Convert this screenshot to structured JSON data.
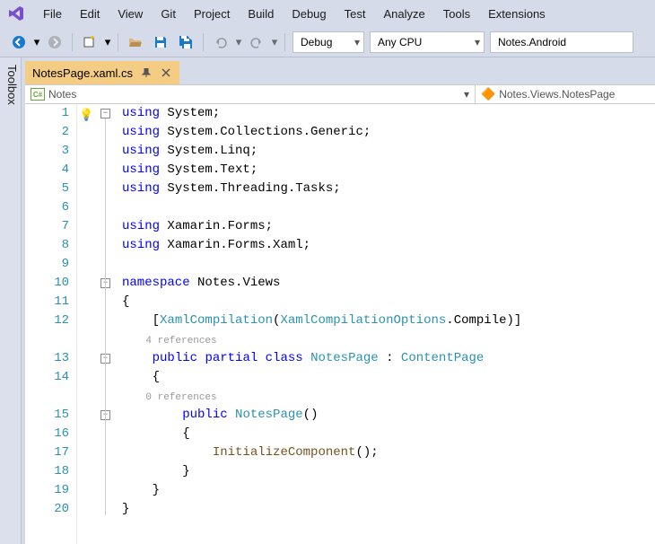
{
  "menu": {
    "items": [
      "File",
      "Edit",
      "View",
      "Git",
      "Project",
      "Build",
      "Debug",
      "Test",
      "Analyze",
      "Tools",
      "Extensions"
    ]
  },
  "toolbar": {
    "debug": "Debug",
    "platform": "Any CPU",
    "startup": "Notes.Android"
  },
  "toolbox_label": "Toolbox",
  "file_tab": {
    "name": "NotesPage.xaml.cs"
  },
  "navbar": {
    "scope": "Notes",
    "member": "Notes.Views.NotesPage"
  },
  "code": {
    "lines": [
      {
        "n": 1,
        "tokens": [
          {
            "t": "kw",
            "v": "using"
          },
          {
            "t": "sp",
            "v": " "
          },
          {
            "t": "na",
            "v": "System"
          },
          {
            "t": "pn",
            "v": ";"
          }
        ]
      },
      {
        "n": 2,
        "tokens": [
          {
            "t": "kw",
            "v": "using"
          },
          {
            "t": "sp",
            "v": " "
          },
          {
            "t": "na",
            "v": "System.Collections.Generic"
          },
          {
            "t": "pn",
            "v": ";"
          }
        ]
      },
      {
        "n": 3,
        "tokens": [
          {
            "t": "kw",
            "v": "using"
          },
          {
            "t": "sp",
            "v": " "
          },
          {
            "t": "na",
            "v": "System.Linq"
          },
          {
            "t": "pn",
            "v": ";"
          }
        ]
      },
      {
        "n": 4,
        "tokens": [
          {
            "t": "kw",
            "v": "using"
          },
          {
            "t": "sp",
            "v": " "
          },
          {
            "t": "na",
            "v": "System.Text"
          },
          {
            "t": "pn",
            "v": ";"
          }
        ]
      },
      {
        "n": 5,
        "tokens": [
          {
            "t": "kw",
            "v": "using"
          },
          {
            "t": "sp",
            "v": " "
          },
          {
            "t": "na",
            "v": "System.Threading.Tasks"
          },
          {
            "t": "pn",
            "v": ";"
          }
        ]
      },
      {
        "n": 6,
        "tokens": []
      },
      {
        "n": 7,
        "tokens": [
          {
            "t": "kw",
            "v": "using"
          },
          {
            "t": "sp",
            "v": " "
          },
          {
            "t": "na",
            "v": "Xamarin.Forms"
          },
          {
            "t": "pn",
            "v": ";"
          }
        ]
      },
      {
        "n": 8,
        "tokens": [
          {
            "t": "kw",
            "v": "using"
          },
          {
            "t": "sp",
            "v": " "
          },
          {
            "t": "na",
            "v": "Xamarin.Forms.Xaml"
          },
          {
            "t": "pn",
            "v": ";"
          }
        ]
      },
      {
        "n": 9,
        "tokens": []
      },
      {
        "n": 10,
        "tokens": [
          {
            "t": "kw",
            "v": "namespace"
          },
          {
            "t": "sp",
            "v": " "
          },
          {
            "t": "na",
            "v": "Notes.Views"
          }
        ]
      },
      {
        "n": 11,
        "tokens": [
          {
            "t": "pn",
            "v": "{"
          }
        ]
      },
      {
        "n": 12,
        "tokens": [
          {
            "t": "sp",
            "v": "    "
          },
          {
            "t": "pn",
            "v": "["
          },
          {
            "t": "tp",
            "v": "XamlCompilation"
          },
          {
            "t": "pn",
            "v": "("
          },
          {
            "t": "tp",
            "v": "XamlCompilationOptions"
          },
          {
            "t": "pn",
            "v": "."
          },
          {
            "t": "id",
            "v": "Compile"
          },
          {
            "t": "pn",
            "v": ")]"
          }
        ]
      },
      {
        "ref": "4 references"
      },
      {
        "n": 13,
        "tokens": [
          {
            "t": "sp",
            "v": "    "
          },
          {
            "t": "kw",
            "v": "public"
          },
          {
            "t": "sp",
            "v": " "
          },
          {
            "t": "kw",
            "v": "partial"
          },
          {
            "t": "sp",
            "v": " "
          },
          {
            "t": "kw",
            "v": "class"
          },
          {
            "t": "sp",
            "v": " "
          },
          {
            "t": "tp",
            "v": "NotesPage"
          },
          {
            "t": "sp",
            "v": " "
          },
          {
            "t": "pn",
            "v": ":"
          },
          {
            "t": "sp",
            "v": " "
          },
          {
            "t": "tp",
            "v": "ContentPage"
          }
        ]
      },
      {
        "n": 14,
        "tokens": [
          {
            "t": "sp",
            "v": "    "
          },
          {
            "t": "pn",
            "v": "{"
          }
        ]
      },
      {
        "ref": "0 references"
      },
      {
        "n": 15,
        "tokens": [
          {
            "t": "sp",
            "v": "        "
          },
          {
            "t": "kw",
            "v": "public"
          },
          {
            "t": "sp",
            "v": " "
          },
          {
            "t": "tp",
            "v": "NotesPage"
          },
          {
            "t": "pn",
            "v": "()"
          }
        ]
      },
      {
        "n": 16,
        "tokens": [
          {
            "t": "sp",
            "v": "        "
          },
          {
            "t": "pn",
            "v": "{"
          }
        ]
      },
      {
        "n": 17,
        "tokens": [
          {
            "t": "sp",
            "v": "            "
          },
          {
            "t": "fn",
            "v": "InitializeComponent"
          },
          {
            "t": "pn",
            "v": "();"
          }
        ]
      },
      {
        "n": 18,
        "tokens": [
          {
            "t": "sp",
            "v": "        "
          },
          {
            "t": "pn",
            "v": "}"
          }
        ]
      },
      {
        "n": 19,
        "tokens": [
          {
            "t": "sp",
            "v": "    "
          },
          {
            "t": "pn",
            "v": "}"
          }
        ]
      },
      {
        "n": 20,
        "tokens": [
          {
            "t": "pn",
            "v": "}"
          }
        ]
      }
    ]
  }
}
